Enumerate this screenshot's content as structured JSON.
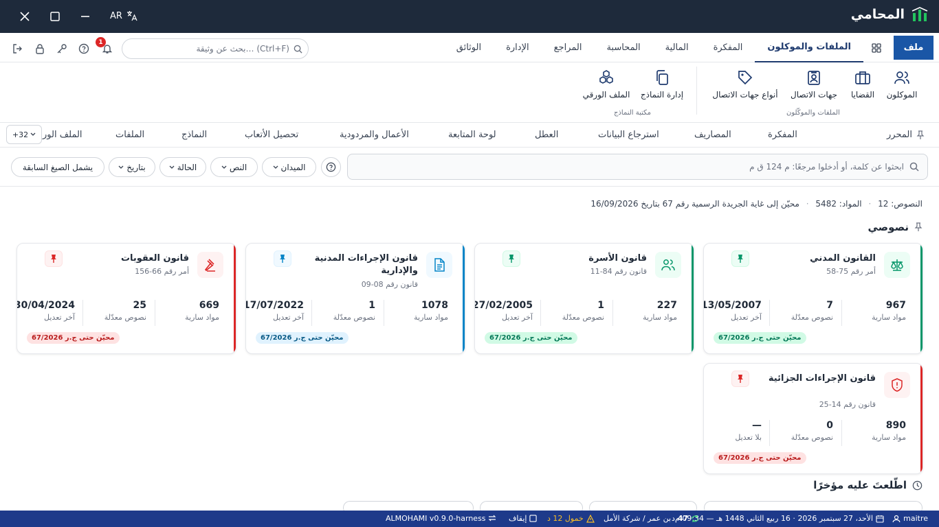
{
  "titlebar": {
    "lang": "AR",
    "app_name": "المحامي"
  },
  "menu": {
    "file": "ملف",
    "tabs": [
      "الملفات والموكلون",
      "المفكرة",
      "المالية",
      "المحاسبة",
      "المراجع",
      "الإدارة",
      "الوثائق"
    ],
    "search_placeholder": "بحث عن وثيقة… (Ctrl+F)",
    "notification_count": "1"
  },
  "ribbon": {
    "group1": {
      "items": [
        "الموكلون",
        "القضايا",
        "جهات الاتصال",
        "أنواع جهات الاتصال"
      ],
      "label": "الملفات والموكّلون"
    },
    "group2": {
      "items": [
        "إدارة النماذج",
        "الملف الورقي"
      ],
      "label": "مكتبة النماذج"
    }
  },
  "doc_tabs": {
    "items": [
      "المحرر",
      "المفكرة",
      "المصاريف",
      "استرجاع البيانات",
      "العطل",
      "لوحة المتابعة",
      "الأعمال والمردودية",
      "تحصيل الأتعاب",
      "النماذج",
      "الملفات",
      "الملف الور"
    ],
    "more": "+32"
  },
  "filters": {
    "search_placeholder": "ابحثوا عن كلمة، أو أدخلوا مرجعًا: م 124 ق م",
    "chips": [
      "الميدان",
      "النص",
      "الحالة",
      "بتاريخ",
      "يشمل الصيغ السابقة"
    ]
  },
  "stats": {
    "texts": "النصوص: 12",
    "articles": "المواد: 5482",
    "updated": "محيّن إلى غاية الجريدة الرسمية رقم 67 بتاريخ 16/09/2026"
  },
  "section_title": "نصوصي",
  "recent_title": "اطّلعتَ عليه مؤخرًا",
  "cards": [
    {
      "title": "القانون المدني",
      "sub": "أمر رقم 75-58",
      "articles": "967",
      "articles_label": "مواد سارية",
      "amended": "7",
      "amended_label": "نصوص معدّلة",
      "date": "13/05/2007",
      "date_label": "آخر تعديل",
      "badge": "محيّن حتى ج.ر 67/2026",
      "color": "#059669",
      "icon": "scale-icon"
    },
    {
      "title": "قانون الأسرة",
      "sub": "قانون رقم 84-11",
      "articles": "227",
      "articles_label": "مواد سارية",
      "amended": "1",
      "amended_label": "نصوص معدّلة",
      "date": "27/02/2005",
      "date_label": "آخر تعديل",
      "badge": "محيّن حتى ج.ر 67/2026",
      "color": "#059669",
      "icon": "users-icon"
    },
    {
      "title": "قانون الإجراءات المدنية والإدارية",
      "sub": "قانون رقم 08-09",
      "articles": "1078",
      "articles_label": "مواد سارية",
      "amended": "1",
      "amended_label": "نصوص معدّلة",
      "date": "17/07/2022",
      "date_label": "آخر تعديل",
      "badge": "محيّن حتى ج.ر 67/2026",
      "color": "#0284c7",
      "icon": "document-icon"
    },
    {
      "title": "قانون العقوبات",
      "sub": "أمر رقم 66-156",
      "articles": "669",
      "articles_label": "مواد سارية",
      "amended": "25",
      "amended_label": "نصوص معدّلة",
      "date": "30/04/2024",
      "date_label": "آخر تعديل",
      "badge": "محيّن حتى ج.ر 67/2026",
      "color": "#dc2626",
      "icon": "gavel-icon"
    },
    {
      "title": "قانون الإجراءات الجزائية",
      "sub": "قانون رقم 14-25",
      "articles": "890",
      "articles_label": "مواد سارية",
      "amended": "0",
      "amended_label": "نصوص معدّلة",
      "date": "—",
      "date_label": "بلا تعديل",
      "badge": "محيّن حتى ج.ر 67/2026",
      "color": "#dc2626",
      "icon": "shield-icon"
    }
  ],
  "statusbar": {
    "user": "maitre",
    "date": "الأحد، 27 سبتمبر 2026 · 16 ربيع الثاني 1448 هـ — 09:34 م",
    "sync_count": "47",
    "sync_unit": "د",
    "office": "بن عمر / شركة الأمل",
    "idle": "خمول 12 د",
    "pause": "إيقاف",
    "version": "ALMOHAMI v0.9.0-harness"
  }
}
